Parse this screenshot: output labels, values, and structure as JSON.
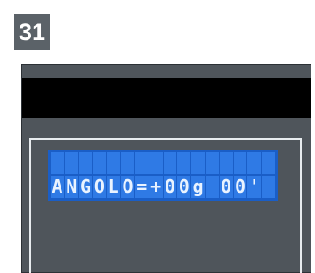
{
  "step_number": "31",
  "lcd": {
    "line1": "",
    "line2": "ANGOLO=+00g 00'",
    "columns": 16,
    "colors": {
      "background": "#1a5ec7",
      "cell": "#2f7ae5",
      "text": "#e9f3ff"
    }
  },
  "colors": {
    "panel": "#4f555b",
    "band": "#000000",
    "badge": "#5b6268"
  }
}
